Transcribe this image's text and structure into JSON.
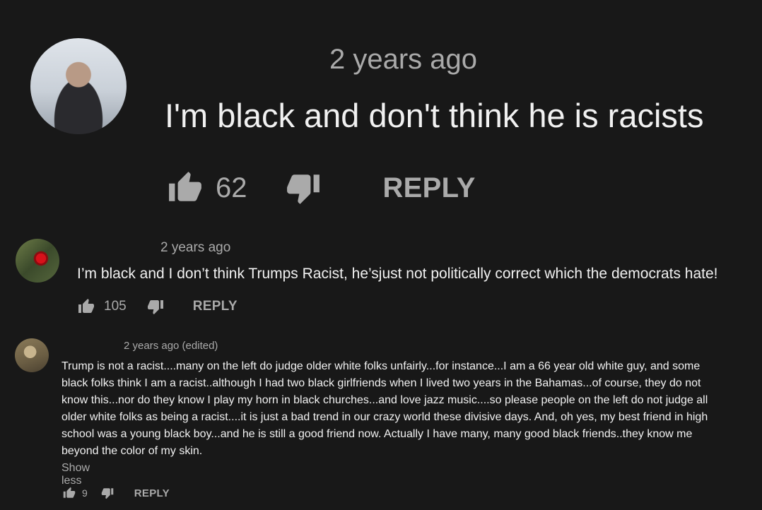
{
  "comments": [
    {
      "timestamp": "2 years ago",
      "text": "I'm black and don't think he is racists",
      "likes": "62",
      "reply_label": "REPLY",
      "avatar_icon": "user-avatar"
    },
    {
      "timestamp": "2 years ago",
      "text": "I’m black and I don’t think Trumps Racist, he’sjust not politically correct which the democrats hate!",
      "likes": "105",
      "reply_label": "REPLY",
      "avatar_icon": "rose-avatar"
    },
    {
      "timestamp": "2 years ago (edited)",
      "text": "Trump is not a racist....many on the left do judge older white folks unfairly...for instance...I am a 66 year old white guy, and some\nblack folks think I am a racist..although I had two black girlfriends when I lived two years in the Bahamas...of course, they do not\nknow this...nor do they know I play my horn in black churches...and love jazz music....so please people on the left do not judge all\nolder white folks as being a racist....it is just a bad trend in our crazy world these divisive days. And, oh yes, my best friend in high\nschool was a young black boy...and he is still a good friend now. Actually I have many, many good black friends..they know me\nbeyond the color of my skin.",
      "show_less_label": "Show less",
      "likes": "9",
      "reply_label": "REPLY",
      "avatar_icon": "user-avatar"
    }
  ],
  "colors": {
    "background": "#181818",
    "text": "#f1f1f1",
    "secondary": "#aaaaaa"
  }
}
